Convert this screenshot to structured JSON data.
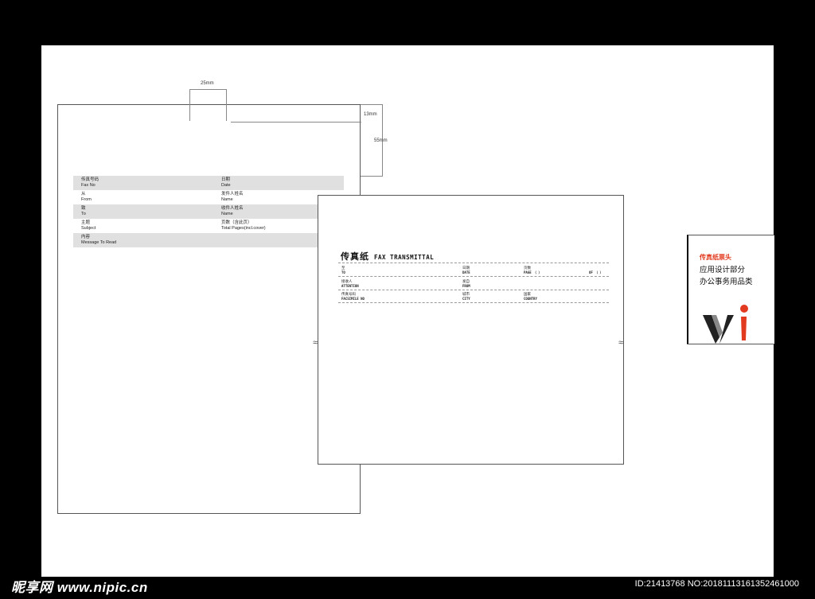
{
  "dimensions": {
    "top_width": "25mm",
    "right_small": "13mm",
    "right_large": "55mm"
  },
  "fax_form": {
    "rows": [
      {
        "left_cn": "传真号码",
        "left_en": "Fax No",
        "right_cn": "日期",
        "right_en": "Date"
      },
      {
        "left_cn": "从",
        "left_en": "From",
        "right_cn": "发件人姓名",
        "right_en": "Name"
      },
      {
        "left_cn": "致",
        "left_en": "To",
        "right_cn": "收件人姓名",
        "right_en": "Name"
      },
      {
        "left_cn": "主题",
        "left_en": "Subject",
        "right_cn": "页数（含此页）",
        "right_en": "Total Pages(incl.cover)"
      },
      {
        "left_cn": "内容",
        "left_en": "Message To Read",
        "right_cn": "",
        "right_en": ""
      }
    ]
  },
  "transmittal": {
    "title_cn": "传真纸",
    "title_en": "FAX TRANSMITTAL",
    "row1": {
      "c1_cn": "至",
      "c1_en": "TO",
      "c2_cn": "日期",
      "c2_en": "DATE",
      "c3_cn": "页数",
      "c3_en": "PAGE （  ）",
      "c4_en": "OF （  ）"
    },
    "row2": {
      "c1_cn": "接收人",
      "c1_en": "ATTENTION",
      "c2_cn": "发自",
      "c2_en": "FROM"
    },
    "row3": {
      "c1_cn": "传真号码",
      "c1_en": "FACSIMILE NO",
      "c2_cn": "城市",
      "c2_en": "CITY",
      "c3_cn": "国家",
      "c3_en": "COUNTRY"
    },
    "break_mark": "≈"
  },
  "panel": {
    "tag": "传真纸票头",
    "line1": "应用设计部分",
    "line2": "办公事务用品类",
    "logo_colors": {
      "dark": "#222222",
      "mid": "#888888",
      "accent": "#e23a1f"
    }
  },
  "watermark": {
    "left": "昵享网 www.nipic.cn",
    "right": "ID:21413768 NO:20181113161352461000"
  }
}
